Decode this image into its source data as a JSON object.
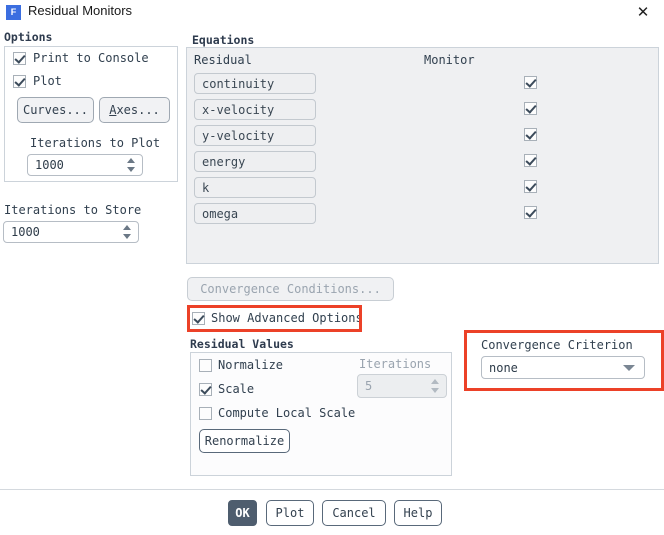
{
  "window": {
    "title": "Residual Monitors",
    "icon_label": "F",
    "close_label": "✕",
    "accent_color": "#3b6ee0",
    "annotation_color": "#ec4128"
  },
  "options": {
    "group_title": "Options",
    "print_to_console": {
      "label": "Print to Console",
      "checked": true
    },
    "plot": {
      "label": "Plot",
      "checked": true
    },
    "curves_button": "Curves...",
    "axes_button": "Axes...",
    "axes_mnemonic": "A",
    "axes_rest": "xes...",
    "iterations_to_plot_label": "Iterations to Plot",
    "iterations_to_plot_value": "1000"
  },
  "iterations_to_store": {
    "label": "Iterations to Store",
    "value": "1000"
  },
  "equations": {
    "group_title": "Equations",
    "col_residual": "Residual",
    "col_monitor": "Monitor",
    "rows": [
      {
        "name": "continuity",
        "monitor": true
      },
      {
        "name": "x-velocity",
        "monitor": true
      },
      {
        "name": "y-velocity",
        "monitor": true
      },
      {
        "name": "energy",
        "monitor": true
      },
      {
        "name": "k",
        "monitor": true
      },
      {
        "name": "omega",
        "monitor": true
      }
    ]
  },
  "convergence_conditions_button": "Convergence Conditions...",
  "show_advanced_options": {
    "label": "Show Advanced Options",
    "checked": true,
    "highlighted": true
  },
  "residual_values": {
    "group_title": "Residual Values",
    "normalize": {
      "label": "Normalize",
      "checked": false
    },
    "scale": {
      "label": "Scale",
      "checked": true
    },
    "compute_local_scale": {
      "label": "Compute Local Scale",
      "checked": false
    },
    "renormalize_button": "Renormalize",
    "iterations_label": "Iterations",
    "iterations_value": "5",
    "iterations_enabled": false
  },
  "convergence_criterion": {
    "label": "Convergence Criterion",
    "value": "none",
    "highlighted": true
  },
  "footer": {
    "ok": "OK",
    "plot": "Plot",
    "cancel": "Cancel",
    "help": "Help"
  }
}
